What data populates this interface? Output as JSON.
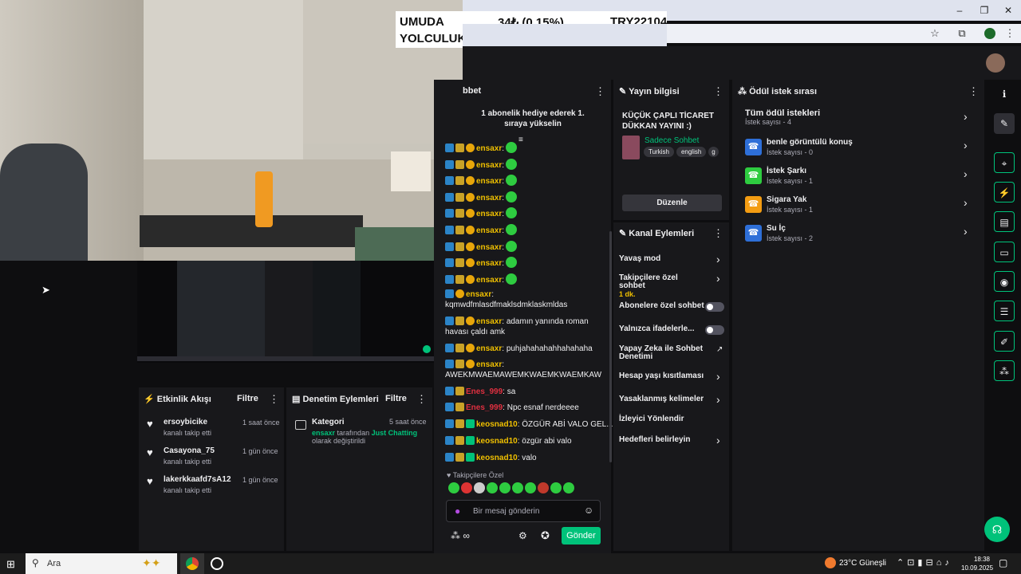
{
  "ticker": {
    "line1": "UMUDA",
    "line2": "YOLCULUK",
    "price": "34₺ (0.15%)",
    "symbol": "TRY22104"
  },
  "browser": {
    "minimize": "–",
    "maximize": "❐",
    "close": "✕"
  },
  "chat": {
    "header": "bbet",
    "pinned": "1 abonelik hediye ederek 1. sıraya yükselin",
    "messages": [
      {
        "user": "ensaxr",
        "color": "#f0c000",
        "text": ""
      },
      {
        "user": "ensaxr",
        "color": "#f0c000",
        "text": ""
      },
      {
        "user": "ensaxr",
        "color": "#f0c000",
        "text": ""
      },
      {
        "user": "ensaxr",
        "color": "#f0c000",
        "text": ""
      },
      {
        "user": "ensaxr",
        "color": "#f0c000",
        "text": ""
      },
      {
        "user": "ensaxr",
        "color": "#f0c000",
        "text": ""
      },
      {
        "user": "ensaxr",
        "color": "#f0c000",
        "text": ""
      },
      {
        "user": "ensaxr",
        "color": "#f0c000",
        "text": ""
      },
      {
        "user": "ensaxr",
        "color": "#f0c000",
        "text": ""
      }
    ],
    "long_messages": [
      {
        "user": "ensaxr",
        "text": "kqmwdfmlasdfmaklsdmklaskmldas"
      },
      {
        "user": "ensaxr",
        "text": "adamın yanında roman havası çaldı amk"
      },
      {
        "user": "ensaxr",
        "text": "puhjahahahahhahahaha"
      },
      {
        "user": "ensaxr",
        "text": "AWEKMWAEMAWEMKWAEMKWAEMKAW"
      },
      {
        "user": "Enes_999",
        "text": "sa"
      },
      {
        "user": "Enes_999",
        "text": "Npc esnaf nerdeeee"
      },
      {
        "user": "keosnad10",
        "text": "ÖZGÜR ABİ VALO GEL..."
      },
      {
        "user": "keosnad10",
        "text": "özgür abi valo"
      },
      {
        "user": "keosnad10",
        "text": "valo"
      }
    ],
    "followers_only": "Takipçilere Özel",
    "input_placeholder": "Bir mesaj gönderin",
    "points": "∞",
    "send": "Gönder"
  },
  "stream_info": {
    "title": "Yayın bilgisi",
    "stream_title": "KÜÇÜK ÇAPLI TİCARET DÜKKAN YAYINI :)",
    "category": "Sadece Sohbet",
    "tags": [
      "Turkish",
      "english",
      "g"
    ],
    "edit": "Düzenle"
  },
  "channel_actions": {
    "title": "Kanal Eylemleri",
    "items": [
      {
        "label": "Yavaş mod",
        "kind": "arrow"
      },
      {
        "label": "Takipçilere özel sohbet",
        "sub": "1 dk.",
        "kind": "arrow"
      },
      {
        "label": "Abonelere özel sohbet",
        "kind": "toggle"
      },
      {
        "label": "Yalnızca ifadelerle...",
        "kind": "toggle"
      },
      {
        "label": "Yapay Zeka ile Sohbet Denetimi",
        "kind": "external"
      },
      {
        "label": "Hesap yaşı kısıtlaması",
        "kind": "arrow"
      },
      {
        "label": "Yasaklanmış kelimeler",
        "kind": "arrow"
      },
      {
        "label": "İzleyici Yönlendir",
        "kind": "none"
      },
      {
        "label": "Hedefleri belirleyin",
        "kind": "arrow"
      }
    ]
  },
  "rewards": {
    "title": "Ödül istek sırası",
    "all": {
      "label": "Tüm ödül istekleri",
      "count": "İstek sayısı - 4"
    },
    "items": [
      {
        "label": "benle görüntülü konuş",
        "count": "İstek sayısı - 0",
        "color": "#2e6fd8"
      },
      {
        "label": "İstek Şarkı",
        "count": "İstek sayısı - 1",
        "color": "#2ecc40"
      },
      {
        "label": "Sigara Yak",
        "count": "İstek sayısı - 1",
        "color": "#f39c12"
      },
      {
        "label": "Su İç",
        "count": "İstek sayısı - 2",
        "color": "#2e6fd8"
      }
    ]
  },
  "activity": {
    "title": "Etkinlik Akışı",
    "filter": "Filtre",
    "items": [
      {
        "user": "ersoybicike",
        "action": "kanalı takip etti",
        "time": "1 saat önce"
      },
      {
        "user": "Casayona_75",
        "action": "kanalı takip etti",
        "time": "1 gün önce"
      },
      {
        "user": "lakerkkaafd7sA12",
        "action": "kanalı takip etti",
        "time": "1 gün önce"
      }
    ]
  },
  "moderation": {
    "title": "Denetim Eylemleri",
    "filter": "Filtre",
    "item": {
      "label": "Kategori",
      "time": "5 saat önce",
      "user": "ensaxr",
      "mid": "tarafından",
      "category": "Just Chatting",
      "suffix": "olarak değiştirildi"
    }
  },
  "taskbar": {
    "search": "Ara",
    "weather": "23°C Güneşli",
    "time": "18:38",
    "date": "10.09.2025"
  }
}
